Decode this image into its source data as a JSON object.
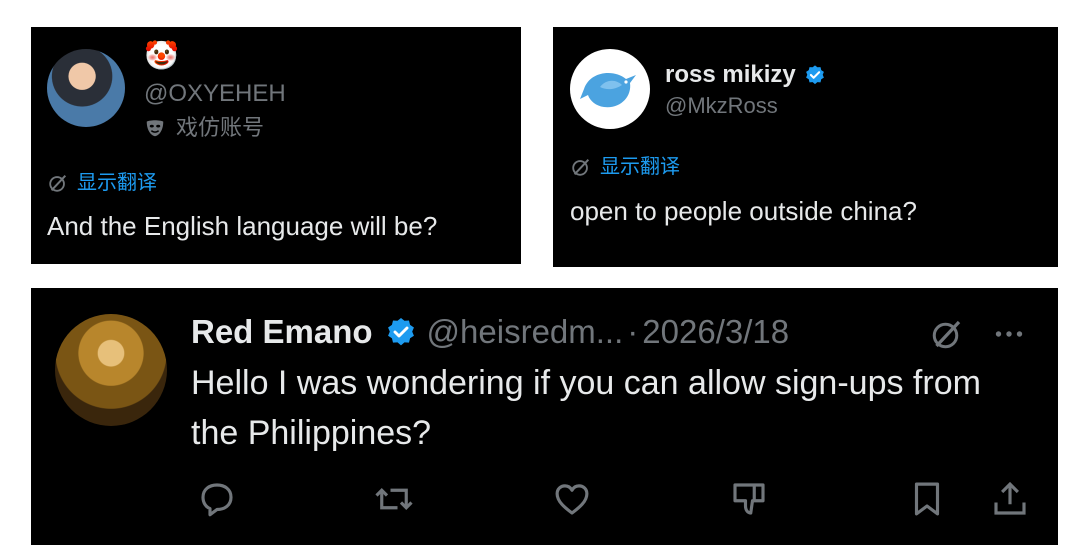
{
  "card1": {
    "emoji": "🤡",
    "handle": "@OXYEHEH",
    "parody_label": "戏仿账号",
    "translate_label": "显示翻译",
    "text": "And the English language will be?"
  },
  "card2": {
    "name": "ross mikizy",
    "handle": "@MkzRoss",
    "translate_label": "显示翻译",
    "text": "open to people outside china?"
  },
  "card3": {
    "name": "Red Emano",
    "handle": "@heisredm...",
    "separator": "·",
    "date": "2026/3/18",
    "text": "Hello I was wondering if you can allow sign-ups from the Philippines?",
    "actions": [
      "reply-icon",
      "retweet-icon",
      "like-icon",
      "dislike-icon",
      "bookmark-icon",
      "share-icon"
    ]
  },
  "colors": {
    "background": "#000000",
    "text": "#e7e9ea",
    "secondary": "#71767b",
    "accent": "#1d9bf0"
  }
}
